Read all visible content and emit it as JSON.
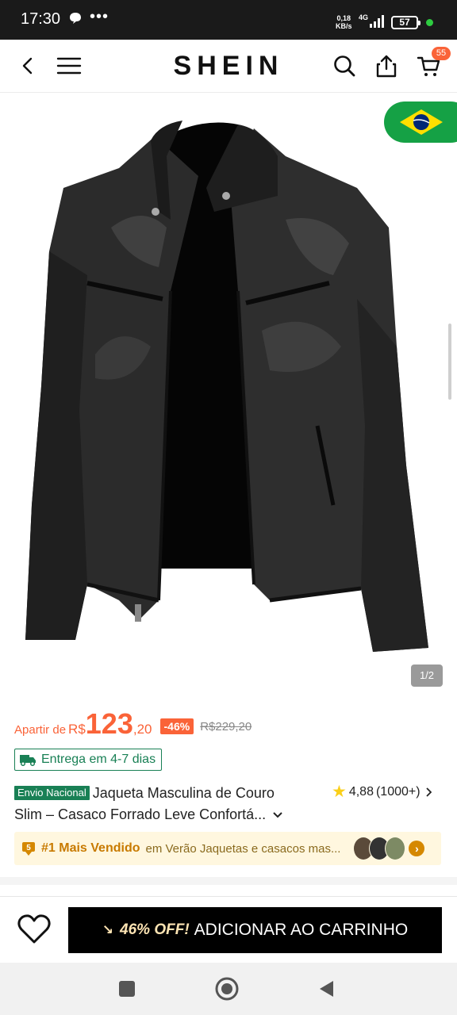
{
  "status_bar": {
    "time": "17:30",
    "net_speed_value": "0,18",
    "net_speed_unit": "KB/s",
    "network": "4G",
    "battery": "57"
  },
  "header": {
    "logo": "SHEIN",
    "cart_count": "55"
  },
  "gallery": {
    "counter": "1/2",
    "flag": "brazil-flag"
  },
  "product": {
    "price_prefix": "Apartir de",
    "currency": "R$",
    "price_main": "123",
    "price_cents": ",20",
    "discount": "-46%",
    "old_price": "R$229,20",
    "delivery": "Entrega em 4-7 dias",
    "badge": "Envio Nacional",
    "title_line1": "Jaqueta Masculina de Couro",
    "title_line2": "Slim – Casaco Forrado Leve Confortá...",
    "rating": "4,88",
    "reviews": "(1000+)"
  },
  "bestseller": {
    "rank": "#1 Mais Vendido",
    "desc": "em Verão Jaquetas e casacos mas..."
  },
  "bottom_bar": {
    "promo": "46% OFF!",
    "button_label": "ADICIONAR AO CARRINHO"
  },
  "colors": {
    "accent": "#fa6338",
    "green": "#198055",
    "button": "#000000"
  }
}
